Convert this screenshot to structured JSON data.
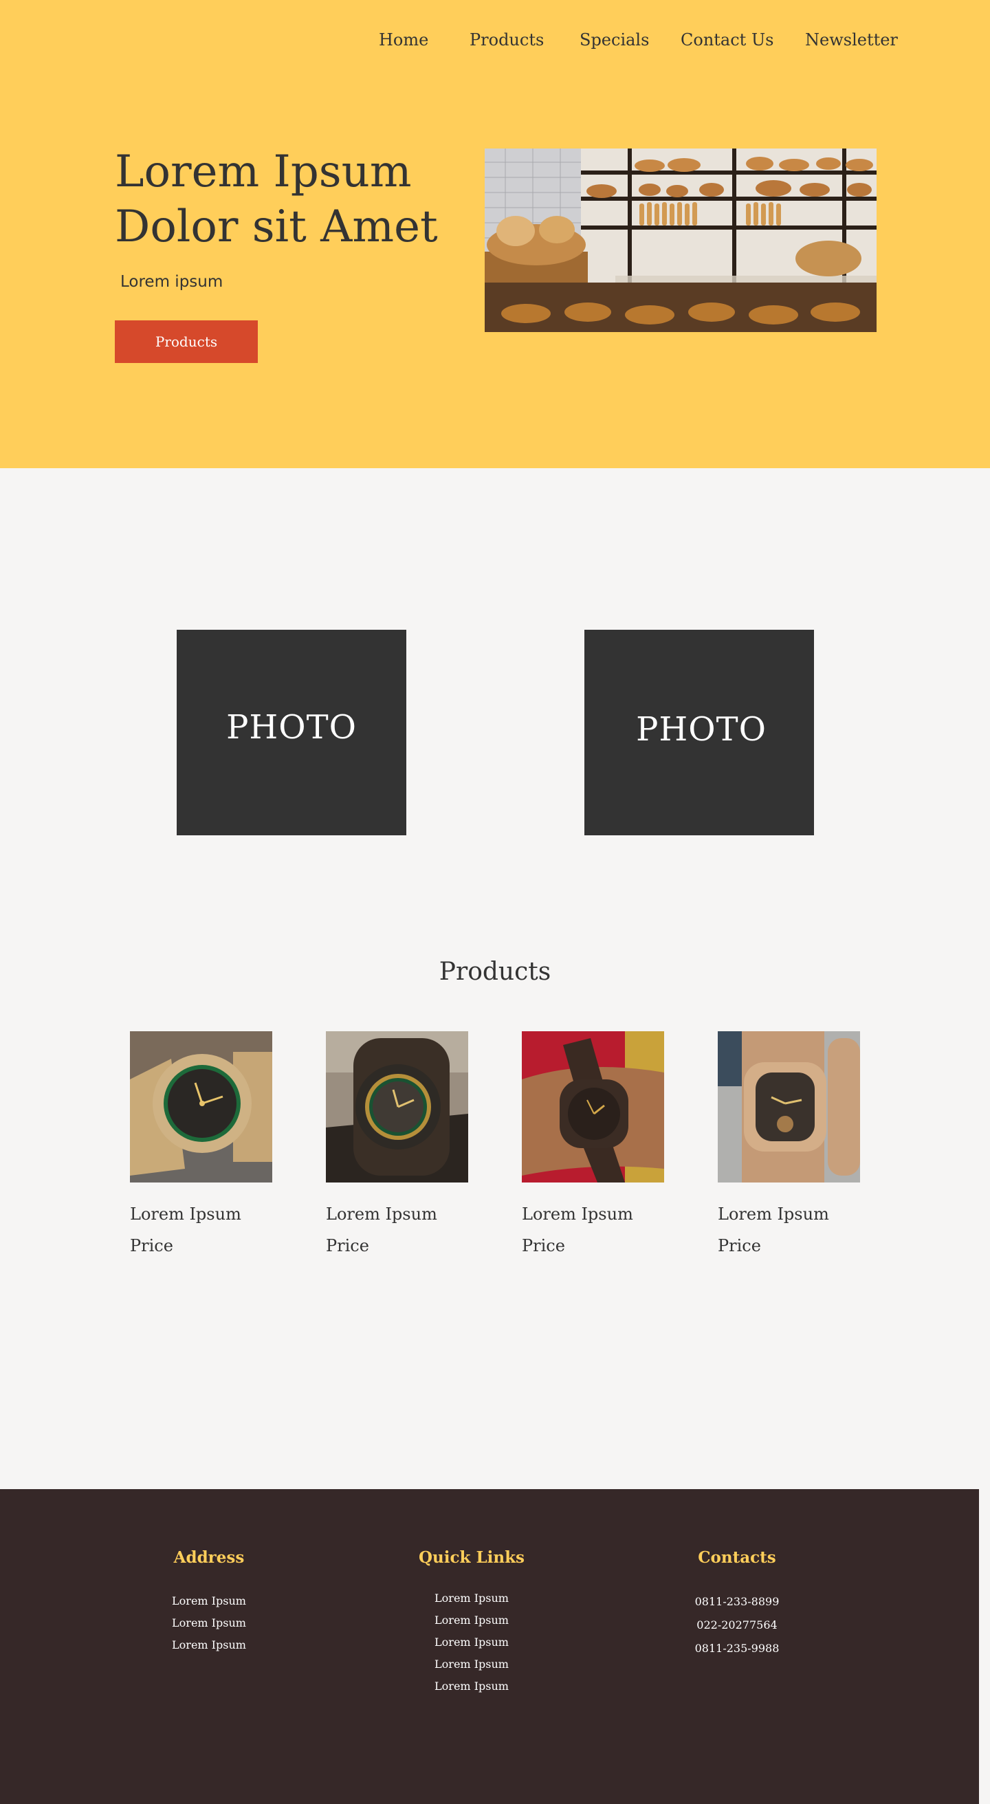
{
  "nav": {
    "items": [
      "Home",
      "Products",
      "Specials",
      "Contact Us",
      "Newsletter"
    ]
  },
  "hero": {
    "title": "Lorem Ipsum Dolor sit Amet",
    "subtitle": "Lorem ipsum",
    "button_label": "Products",
    "image": "bakery-shelves-photo"
  },
  "photos": {
    "left_label": "PHOTO",
    "right_label": "PHOTO"
  },
  "products": {
    "heading": "Products",
    "items": [
      {
        "name": "Lorem Ipsum",
        "price": "Price",
        "image": "wooden-watch-green-dial"
      },
      {
        "name": "Lorem Ipsum",
        "price": "Price",
        "image": "dark-wooden-watch-gold-dial"
      },
      {
        "name": "Lorem Ipsum",
        "price": "Price",
        "image": "dark-watch-on-wrist"
      },
      {
        "name": "Lorem Ipsum",
        "price": "Price",
        "image": "light-wooden-square-watch"
      }
    ]
  },
  "footer": {
    "address": {
      "heading": "Address",
      "lines": [
        "Lorem Ipsum",
        "Lorem Ipsum",
        "Lorem Ipsum"
      ]
    },
    "quick_links": {
      "heading": "Quick Links",
      "links": [
        "Lorem Ipsum",
        "Lorem Ipsum",
        "Lorem Ipsum",
        "Lorem Ipsum",
        "Lorem Ipsum"
      ]
    },
    "contacts": {
      "heading": "Contacts",
      "phones": [
        "0811-233-8899",
        "022-20277564",
        "0811-235-9988"
      ]
    }
  },
  "colors": {
    "hero_background": "#ffce5a",
    "page_background": "#f6f5f4",
    "button": "#d6492b",
    "photo_box": "#333333",
    "footer_background": "#362828",
    "footer_heading": "#ffce5a",
    "text": "#333333"
  }
}
